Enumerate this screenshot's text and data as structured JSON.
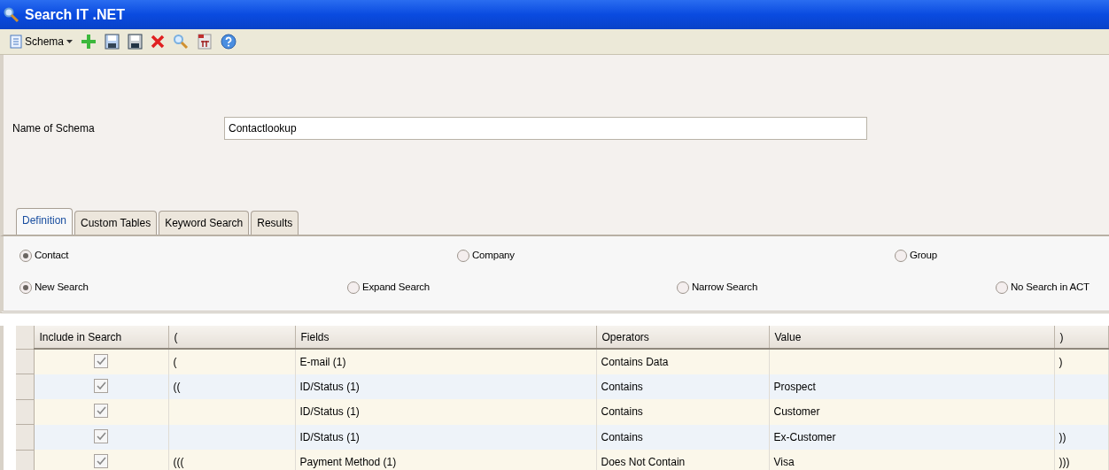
{
  "window": {
    "title": "Search IT .NET"
  },
  "toolbar": {
    "schema_menu": "Schema"
  },
  "form": {
    "label": "Name of Schema",
    "value": "Contactlookup"
  },
  "tabs": [
    {
      "label": "Definition",
      "selected": true
    },
    {
      "label": "Custom Tables",
      "selected": false
    },
    {
      "label": "Keyword Search",
      "selected": false
    },
    {
      "label": "Results",
      "selected": false
    }
  ],
  "record_type": [
    {
      "label": "Contact",
      "selected": true
    },
    {
      "label": "Company",
      "selected": false
    },
    {
      "label": "Group",
      "selected": false
    }
  ],
  "search_mode": [
    {
      "label": "New Search",
      "selected": true
    },
    {
      "label": "Expand Search",
      "selected": false
    },
    {
      "label": "Narrow Search",
      "selected": false
    },
    {
      "label": "No Search in ACT",
      "selected": false
    }
  ],
  "table": {
    "columns": [
      "Include in Search",
      "(",
      "Fields",
      "Operators",
      "Value",
      ")"
    ],
    "rows": [
      {
        "include": true,
        "open": "(",
        "field": "E-mail (1)",
        "operator": "Contains Data",
        "close": ")"
      },
      {
        "include": true,
        "open": "((",
        "field": "ID/Status (1)",
        "operator": "Contains",
        "value": "Prospect"
      },
      {
        "include": true,
        "field": "ID/Status (1)",
        "operator": "Contains",
        "value": "Customer"
      },
      {
        "include": true,
        "field": "ID/Status (1)",
        "operator": "Contains",
        "value": "Ex-Customer",
        "close": "))"
      },
      {
        "include": true,
        "open": "(((",
        "field": "Payment Method (1)",
        "operator": "Does Not Contain",
        "value": "Visa",
        "close": ")))"
      }
    ]
  }
}
